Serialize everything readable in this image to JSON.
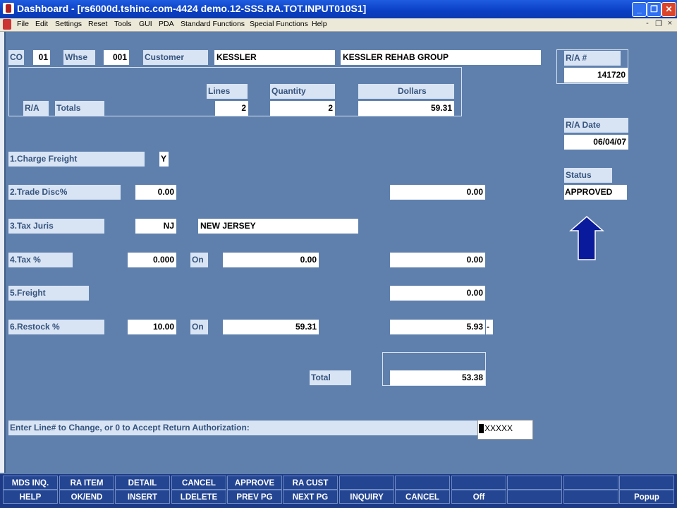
{
  "window": {
    "title": "Dashboard - [rs6000d.tshinc.com-4424 demo.12-SSS.RA.TOT.INPUT010S1]",
    "min_glyph": "_",
    "max_glyph": "❐",
    "close_glyph": "✕"
  },
  "menubar": {
    "items": [
      "File",
      "Edit",
      "Settings",
      "Reset",
      "Tools",
      "GUI",
      "PDA",
      "Standard Functions",
      "Special Functions",
      "Help"
    ],
    "mdi_min": "-",
    "mdi_restore": "❐",
    "mdi_close": "×"
  },
  "header": {
    "co_label": "CO",
    "co_value": "01",
    "whse_label": "Whse",
    "whse_value": "001",
    "customer_label": "Customer",
    "customer_code": "KESSLER",
    "customer_name": "KESSLER REHAB GROUP",
    "ra_num_label": "R/A #",
    "ra_num_value": "141720"
  },
  "totals": {
    "ra_label": "R/A",
    "totals_label": "Totals",
    "lines_label": "Lines",
    "lines_value": "2",
    "quantity_label": "Quantity",
    "quantity_value": "2",
    "dollars_label": "Dollars",
    "dollars_value": "59.31"
  },
  "ra_date": {
    "label": "R/A Date",
    "value": "06/04/07"
  },
  "status": {
    "label": "Status",
    "value": "APPROVED"
  },
  "fields": {
    "charge_freight_label": "1.Charge Freight",
    "charge_freight_value": "Y",
    "trade_disc_label": "2.Trade Disc%",
    "trade_disc_value": "0.00",
    "trade_disc_amount": "0.00",
    "tax_juris_label": "3.Tax Juris",
    "tax_juris_code": "NJ",
    "tax_juris_name": "NEW JERSEY",
    "tax_pct_label": "4.Tax %",
    "tax_pct_value": "0.000",
    "tax_on_label": "On",
    "tax_on_value": "0.00",
    "tax_amount": "0.00",
    "freight_label": "5.Freight",
    "freight_amount": "0.00",
    "restock_label": "6.Restock %",
    "restock_value": "10.00",
    "restock_on_label": "On",
    "restock_on_value": "59.31",
    "restock_amount": "5.93",
    "restock_suffix": "-",
    "total_label": "Total",
    "total_value": "53.38"
  },
  "prompt": {
    "label": "Enter Line# to Change, or 0 to Accept Return Authorization:",
    "input_value": "XXXXX"
  },
  "fkeys": {
    "row1": [
      "MDS INQ.",
      "RA ITEM",
      "DETAIL",
      "CANCEL",
      "APPROVE",
      "RA CUST",
      "",
      "",
      "",
      "",
      "",
      ""
    ],
    "row2": [
      "HELP",
      "OK/END",
      "INSERT",
      "LDELETE",
      "PREV PG",
      "NEXT PG",
      "INQUIRY",
      "CANCEL",
      "Off",
      "",
      "",
      "Popup"
    ]
  },
  "colors": {
    "background": "#5f80ad",
    "label_bg": "#d8e4f4",
    "label_text": "#36547e",
    "fkey_bg": "#244591",
    "arrow": "#0a1a9c"
  },
  "icons": {
    "app": "app-icon",
    "arrow": "up-arrow-icon"
  }
}
